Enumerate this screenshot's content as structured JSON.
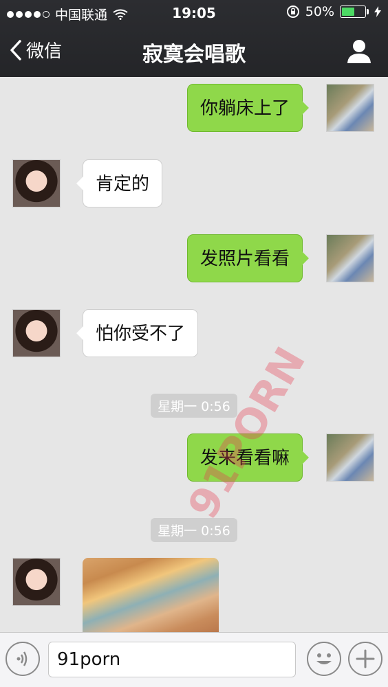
{
  "status_bar": {
    "carrier": "中国联通",
    "time": "19:05",
    "battery": "50%"
  },
  "nav": {
    "back_label": "微信",
    "title": "寂寞会唱歌"
  },
  "messages": [
    {
      "sender": "me",
      "text": "你躺床上了"
    },
    {
      "sender": "her",
      "text": "肯定的"
    },
    {
      "sender": "me",
      "text": "发照片看看"
    },
    {
      "sender": "her",
      "text": "怕你受不了"
    },
    {
      "timestamp": "星期一 0:56"
    },
    {
      "sender": "me",
      "text": "发来看看嘛"
    },
    {
      "timestamp": "星期一 0:56"
    },
    {
      "sender": "her",
      "type": "photo"
    }
  ],
  "input": {
    "value": "91porn"
  },
  "watermark": "91PORN",
  "colors": {
    "topbar": "#242528",
    "bubble_me": "#8fd84a",
    "bubble_her": "#ffffff",
    "chat_bg": "#e6e6e6"
  }
}
